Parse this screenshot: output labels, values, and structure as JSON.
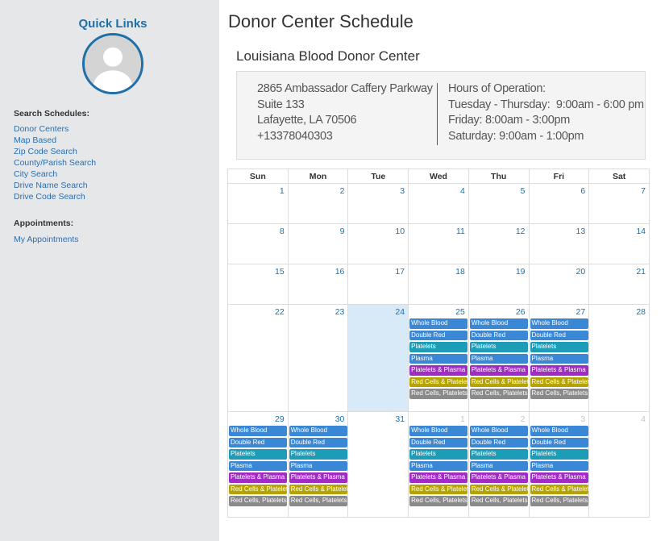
{
  "sidebar": {
    "title": "Quick Links",
    "search_heading": "Search Schedules:",
    "search_links": [
      "Donor Centers",
      "Map Based",
      "Zip Code Search",
      "County/Parish Search",
      "City Search",
      "Drive Name Search",
      "Drive Code Search"
    ],
    "appointments_heading": "Appointments:",
    "appointment_links": [
      "My Appointments"
    ]
  },
  "main": {
    "title": "Donor Center Schedule",
    "center_name": "Louisiana Blood Donor Center",
    "address": [
      "2865 Ambassador Caffery Parkway",
      "Suite 133",
      "Lafayette, LA 70506",
      "+13378040303"
    ],
    "hours_label": "Hours of Operation:",
    "hours": [
      "Tuesday - Thursday:  9:00am - 6:00 pm",
      "Friday: 8:00am - 3:00pm",
      "Saturday: 9:00am - 1:00pm"
    ]
  },
  "calendar": {
    "weekdays": [
      "Sun",
      "Mon",
      "Tue",
      "Wed",
      "Thu",
      "Fri",
      "Sat"
    ],
    "today": "24",
    "weeks": [
      [
        {
          "day": "1"
        },
        {
          "day": "2"
        },
        {
          "day": "3"
        },
        {
          "day": "4"
        },
        {
          "day": "5"
        },
        {
          "day": "6"
        },
        {
          "day": "7"
        }
      ],
      [
        {
          "day": "8"
        },
        {
          "day": "9"
        },
        {
          "day": "10"
        },
        {
          "day": "11"
        },
        {
          "day": "12"
        },
        {
          "day": "13"
        },
        {
          "day": "14"
        }
      ],
      [
        {
          "day": "15"
        },
        {
          "day": "16"
        },
        {
          "day": "17"
        },
        {
          "day": "18"
        },
        {
          "day": "19"
        },
        {
          "day": "20"
        },
        {
          "day": "21"
        }
      ],
      [
        {
          "day": "22"
        },
        {
          "day": "23"
        },
        {
          "day": "24",
          "today": true
        },
        {
          "day": "25",
          "events": true
        },
        {
          "day": "26",
          "events": true
        },
        {
          "day": "27",
          "events": true
        },
        {
          "day": "28"
        }
      ],
      [
        {
          "day": "29",
          "events": true
        },
        {
          "day": "30",
          "events": true
        },
        {
          "day": "31"
        },
        {
          "day": "1",
          "other": true,
          "events": true
        },
        {
          "day": "2",
          "other": true,
          "events": true
        },
        {
          "day": "3",
          "other": true,
          "events": true
        },
        {
          "day": "4",
          "other": true
        }
      ]
    ],
    "event_types": [
      {
        "label": "Whole Blood",
        "color": "#3a87d6"
      },
      {
        "label": "Double Red",
        "color": "#3a87d6"
      },
      {
        "label": "Platelets",
        "color": "#1d9cb8"
      },
      {
        "label": "Plasma",
        "color": "#3a87d6"
      },
      {
        "label": "Platelets & Plasma",
        "color": "#a02cc4"
      },
      {
        "label": "Red Cells & Platelets",
        "color": "#b5a400"
      },
      {
        "label": "Red Cells, Platelets",
        "color": "#8a8a8a"
      }
    ],
    "row_heights": [
      50,
      50,
      50,
      133,
      131
    ]
  }
}
